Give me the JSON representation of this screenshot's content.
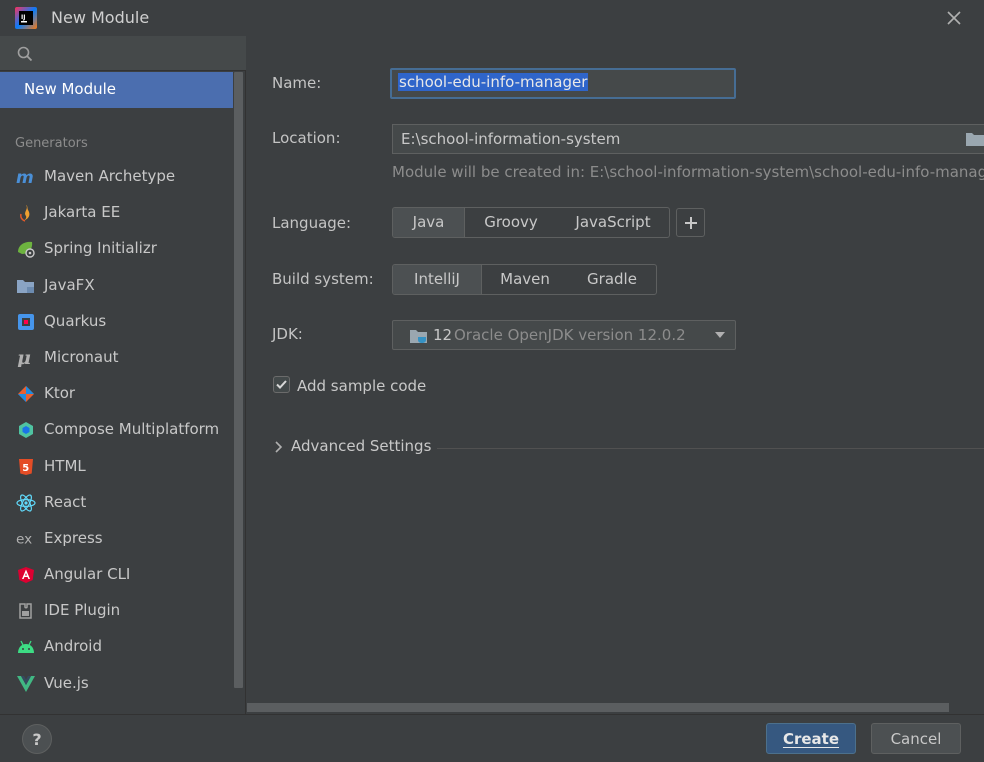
{
  "window": {
    "title": "New Module",
    "logo_icon": "intellij-logo-icon",
    "close_icon": "close-icon"
  },
  "sidebar": {
    "search_icon": "search-icon",
    "selected": "New Module",
    "section_label": "Generators",
    "items": [
      {
        "label": "Maven Archetype",
        "icon": "maven-icon",
        "color": "#4a8fd6"
      },
      {
        "label": "Jakarta EE",
        "icon": "jakarta-ee-icon",
        "color": "#f0a030"
      },
      {
        "label": "Spring Initializr",
        "icon": "spring-icon",
        "color": "#6db33f"
      },
      {
        "label": "JavaFX",
        "icon": "javafx-folder-icon",
        "color": "#8aa4c4"
      },
      {
        "label": "Quarkus",
        "icon": "quarkus-icon",
        "color": "#4695eb"
      },
      {
        "label": "Micronaut",
        "icon": "micronaut-icon",
        "color": "#b0b0b0"
      },
      {
        "label": "Ktor",
        "icon": "ktor-icon",
        "color": "#e86030"
      },
      {
        "label": "Compose Multiplatform",
        "icon": "compose-icon",
        "color": "#4fc3a1"
      },
      {
        "label": "HTML",
        "icon": "html5-icon",
        "color": "#e44d26"
      },
      {
        "label": "React",
        "icon": "react-icon",
        "color": "#61dafb"
      },
      {
        "label": "Express",
        "icon": "express-icon",
        "color": "#b0b0b0"
      },
      {
        "label": "Angular CLI",
        "icon": "angular-icon",
        "color": "#dd0031"
      },
      {
        "label": "IDE Plugin",
        "icon": "ide-plugin-icon",
        "color": "#a0a0a0"
      },
      {
        "label": "Android",
        "icon": "android-icon",
        "color": "#3ddc84"
      },
      {
        "label": "Vue.js",
        "icon": "vue-icon",
        "color": "#41b883"
      }
    ]
  },
  "form": {
    "name_label": "Name:",
    "name_value": "school-edu-info-manager",
    "location_label": "Location:",
    "location_value": "E:\\school-information-system",
    "location_hint": "Module will be created in: E:\\school-information-system\\school-edu-info-manage",
    "language_label": "Language:",
    "languages": [
      "Java",
      "Groovy",
      "JavaScript"
    ],
    "language_selected": "Java",
    "add_language_icon": "plus-icon",
    "build_label": "Build system:",
    "build_systems": [
      "IntelliJ",
      "Maven",
      "Gradle"
    ],
    "build_selected": "IntelliJ",
    "jdk_label": "JDK:",
    "jdk_version": "12",
    "jdk_name": "Oracle OpenJDK version 12.0.2",
    "sample_code_label": "Add sample code",
    "sample_code_checked": true,
    "advanced_label": "Advanced Settings"
  },
  "footer": {
    "help_label": "?",
    "create_label": "Create",
    "cancel_label": "Cancel"
  },
  "colors": {
    "background": "#3c3f41",
    "selection": "#4b6eaf",
    "primary_button": "#365880",
    "text": "#bbbbbb"
  }
}
